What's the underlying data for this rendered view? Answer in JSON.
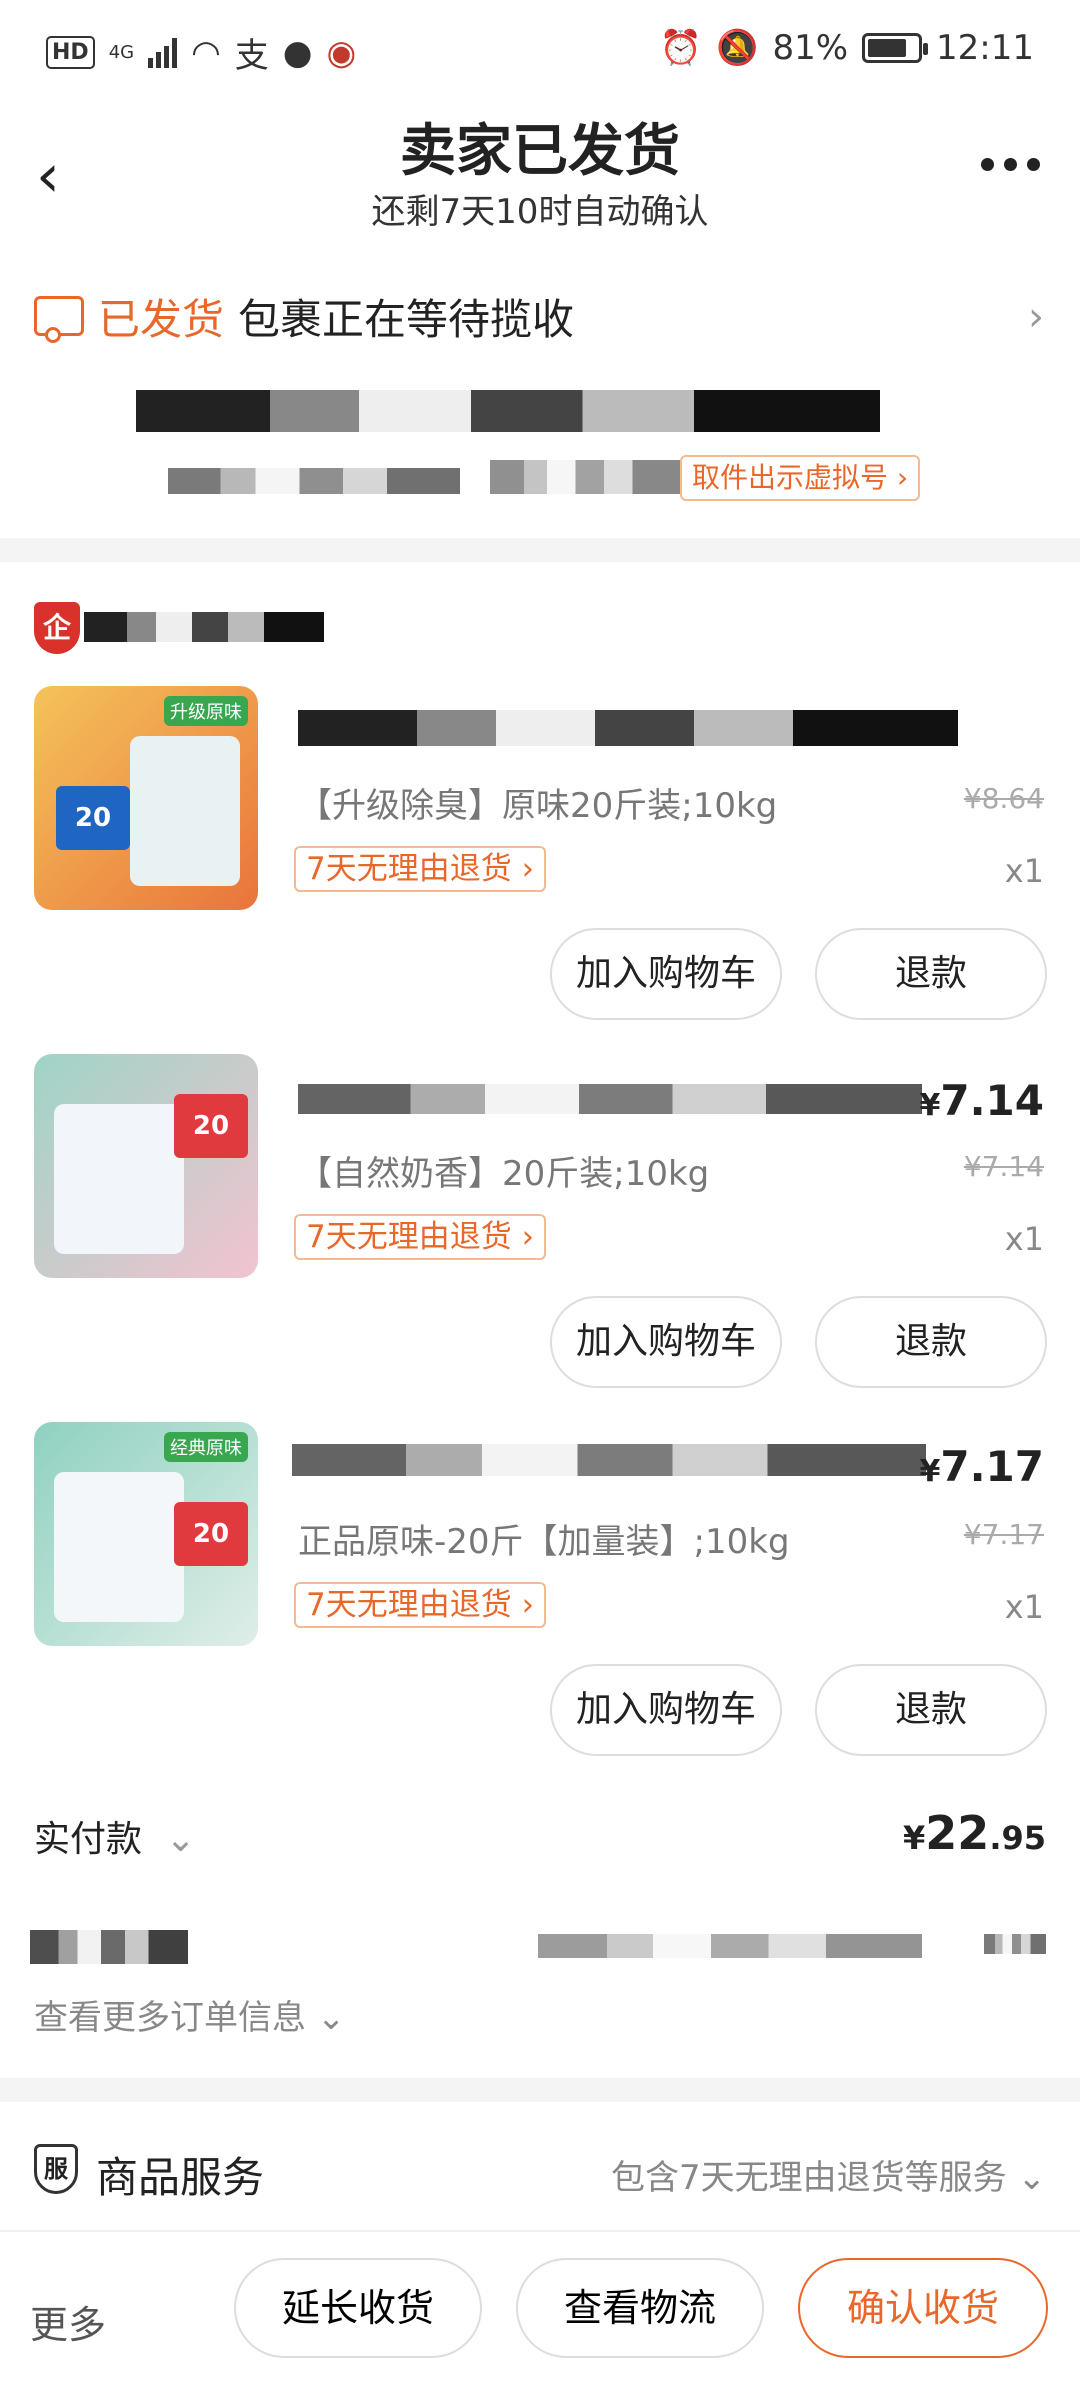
{
  "status_bar": {
    "battery": "81%",
    "time": "12:11",
    "net": "4G"
  },
  "header": {
    "title": "卖家已发货",
    "subtitle": "还剩7天10时自动确认"
  },
  "shipping": {
    "status": "已发货",
    "message": "包裹正在等待揽收",
    "pickup_label": "取件出示虚拟号 ›"
  },
  "items": [
    {
      "sku": "【升级除臭】原味20斤装;10kg",
      "price_symbol": "¥",
      "price": "",
      "original_price": "¥8.64",
      "quantity": "x1",
      "refund_tag": "7天无理由退货 ›",
      "add_cart": "加入购物车",
      "refund": "退款",
      "badge": "20",
      "tag": "升级原味"
    },
    {
      "sku": "【自然奶香】20斤装;10kg",
      "price_symbol": "¥",
      "price": "7.14",
      "original_price": "¥7.14",
      "quantity": "x1",
      "refund_tag": "7天无理由退货 ›",
      "add_cart": "加入购物车",
      "refund": "退款",
      "badge": "20",
      "tag": ""
    },
    {
      "sku": "正品原味-20斤【加量装】;10kg",
      "price_symbol": "¥",
      "price": "7.17",
      "original_price": "¥7.17",
      "quantity": "x1",
      "refund_tag": "7天无理由退货 ›",
      "add_cart": "加入购物车",
      "refund": "退款",
      "badge": "20",
      "tag": "经典原味"
    }
  ],
  "summary": {
    "total_label": "实付款",
    "total_symbol": "¥",
    "total_int": "22",
    "total_dec": ".95",
    "more_info": "查看更多订单信息"
  },
  "service": {
    "icon": "服",
    "title": "商品服务",
    "desc": "包含7天无理由退货等服务"
  },
  "bottom": {
    "more": "更多",
    "extend": "延长收货",
    "logistics": "查看物流",
    "confirm": "确认收货"
  },
  "shop": {
    "icon": "企"
  }
}
